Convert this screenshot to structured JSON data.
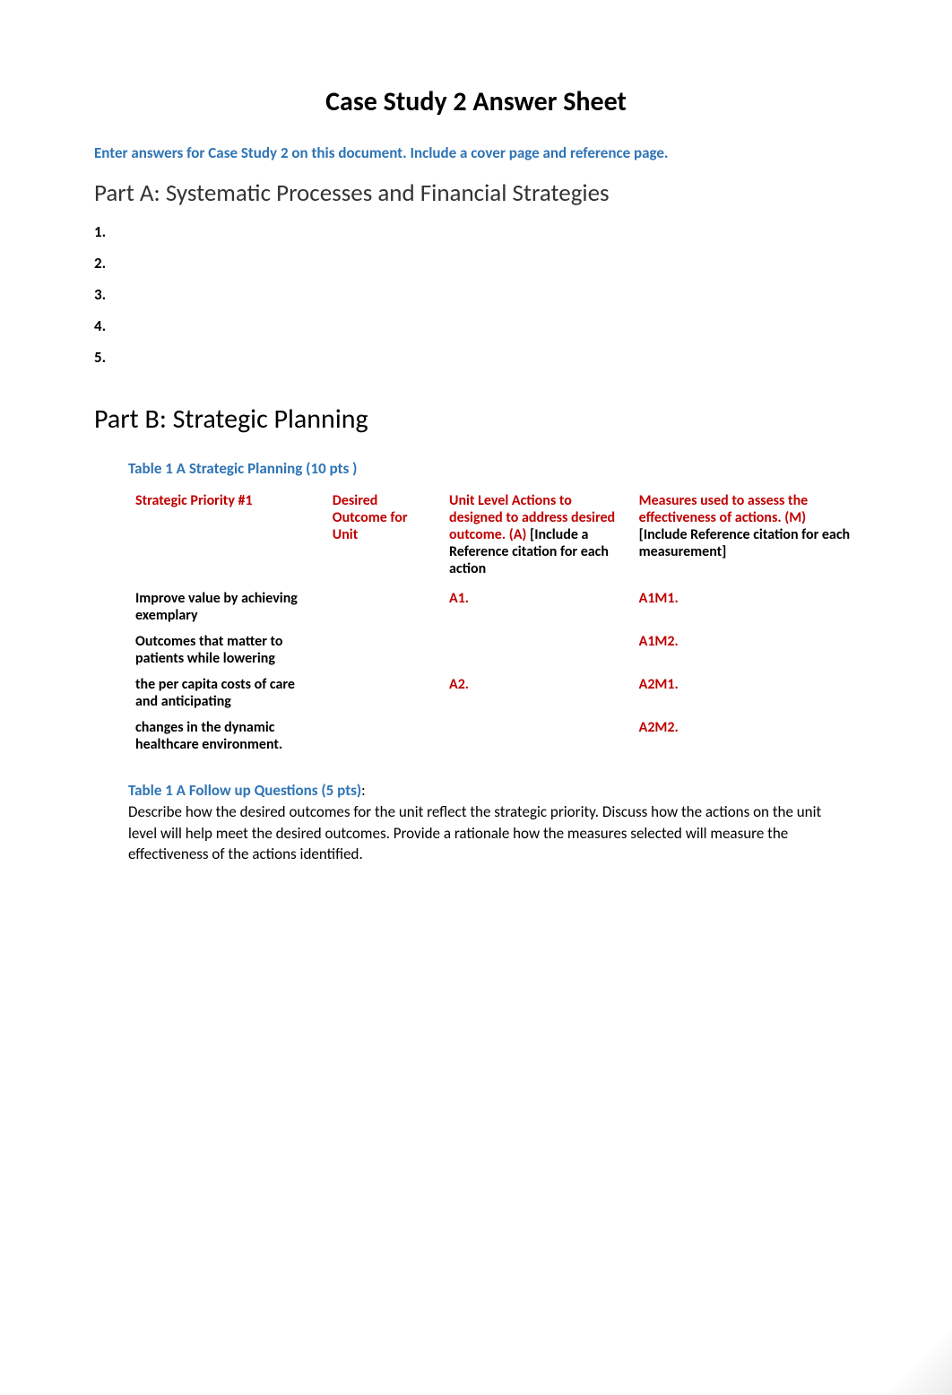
{
  "title": "Case Study 2 Answer Sheet",
  "instruction": "Enter answers for Case Study 2 on this document. Include a cover page and reference page.",
  "partA": {
    "heading": "Part A: Systematic Processes and Financial Strategies",
    "items": [
      "1.",
      "2.",
      "3.",
      "4.",
      "5."
    ]
  },
  "partB": {
    "heading": "Part B: Strategic Planning",
    "table1": {
      "caption": "Table 1 A Strategic Planning (10 pts )",
      "headers": {
        "col1": "Strategic Priority #1",
        "col2": "Desired Outcome for Unit",
        "col3_red": "Unit Level Actions to designed to address desired outcome. (A)",
        "col3_black": " [Include a Reference citation for each action",
        "col4_red": " Measures used to assess the effectiveness of actions.  (M)",
        "col4_black": " [Include Reference citation for each measurement]"
      },
      "priority_text_1": "Improve value by achieving exemplary",
      "priority_text_2": "Outcomes that matter to patients while lowering",
      "priority_text_3": "the per capita costs of care and anticipating",
      "priority_text_4": "changes in the dynamic healthcare environment.",
      "actions": {
        "a1": "A1.",
        "a2": "A2."
      },
      "measures": {
        "a1m1": "A1M1.",
        "a1m2": "A1M2.",
        "a2m1": "A2M1.",
        "a2m2": "A2M2."
      }
    },
    "followup": {
      "label": "Table 1 A Follow up Questions (5 pts)",
      "colon": ":",
      "text": "Describe how the desired outcomes for the unit reflect the strategic priority. Discuss how the actions on the unit level will help meet the desired outcomes. Provide a rationale how the measures selected will measure the effectiveness of the actions identified."
    }
  }
}
